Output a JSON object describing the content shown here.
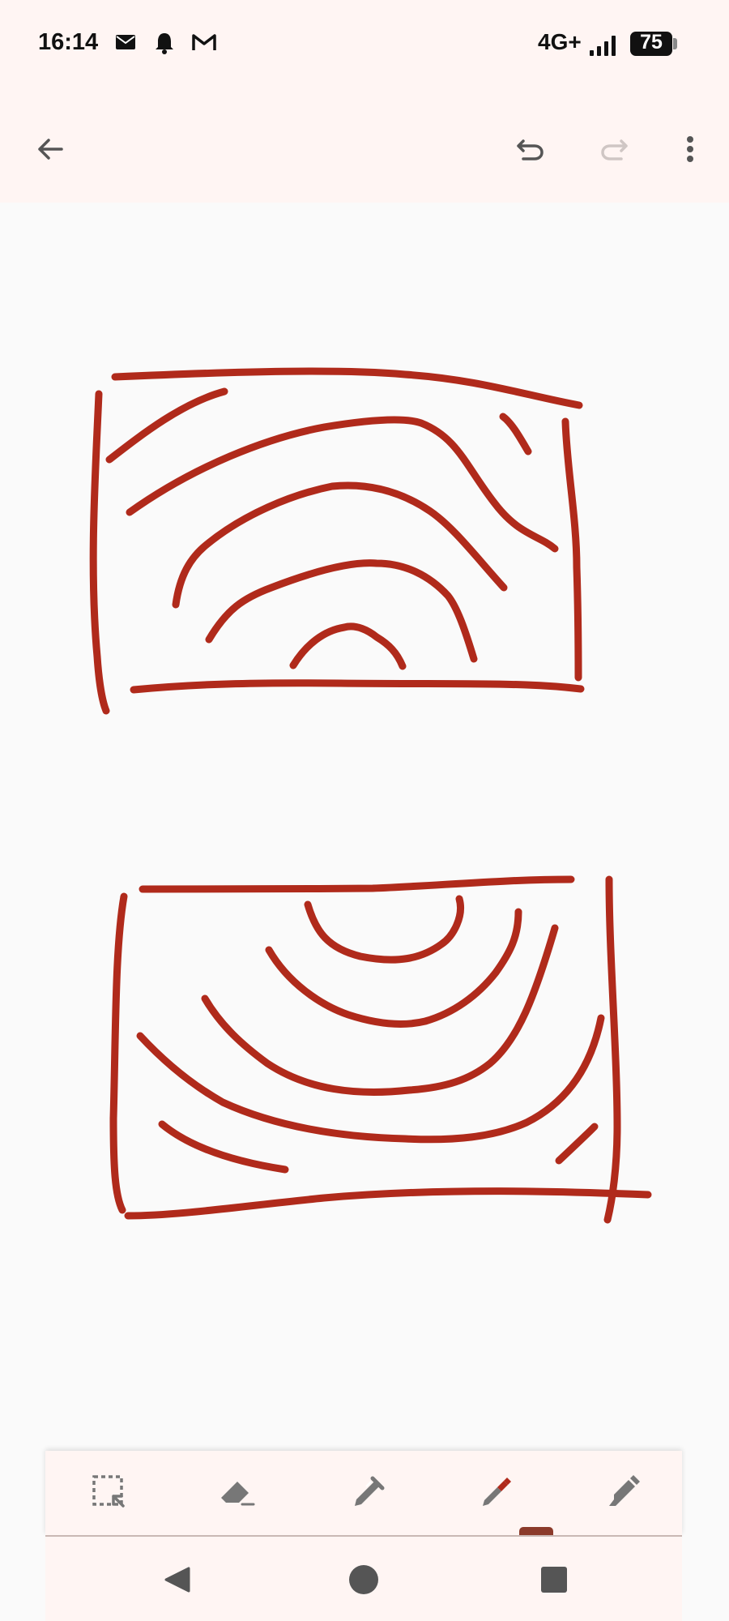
{
  "status_bar": {
    "time": "16:14",
    "notification_icons": [
      "email-icon",
      "bell-icon",
      "gmail-icon"
    ],
    "network": "4G+",
    "battery": "75"
  },
  "toolbar": {
    "icons": [
      "back-arrow-icon",
      "undo-icon",
      "redo-icon",
      "more-options-icon"
    ]
  },
  "canvas": {
    "stroke_color": "#b02a1b"
  },
  "tools": {
    "items": [
      "lasso-select-icon",
      "eraser-icon",
      "pen-icon",
      "marker-icon",
      "highlighter-icon"
    ],
    "selected": "marker-icon",
    "marker_color": "#b02a1b"
  },
  "nav_bar": {
    "icons": [
      "back-triangle-icon",
      "home-circle-icon",
      "recents-square-icon"
    ]
  }
}
